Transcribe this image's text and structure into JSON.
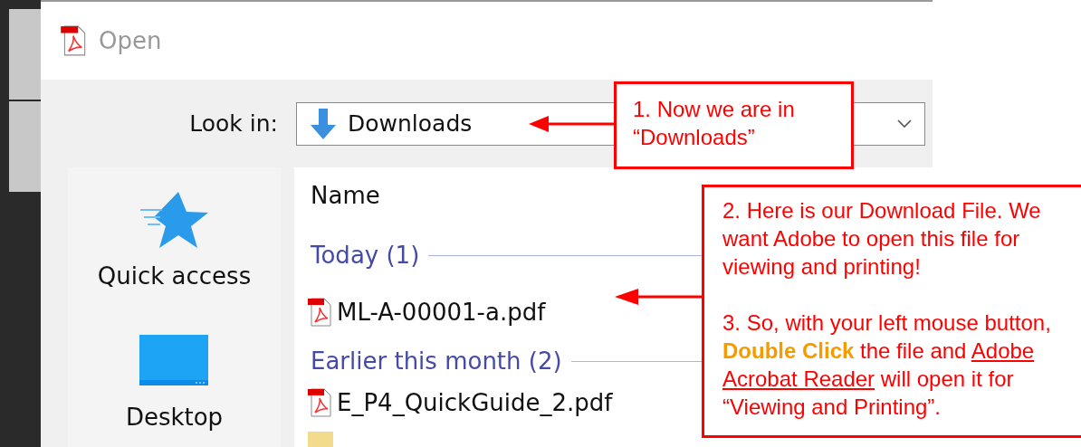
{
  "window": {
    "title": "Open"
  },
  "look_in": {
    "label": "Look in:",
    "value": "Downloads"
  },
  "sidebar": {
    "items": [
      {
        "label": "Quick access",
        "kind": "star"
      },
      {
        "label": "Desktop",
        "kind": "desktop"
      }
    ]
  },
  "file_list": {
    "column": "Name",
    "groups": [
      {
        "title": "Today (1)",
        "files": [
          {
            "name": "ML-A-00001-a.pdf",
            "kind": "pdf"
          }
        ]
      },
      {
        "title": "Earlier this month (2)",
        "files": [
          {
            "name": "E_P4_QuickGuide_2.pdf",
            "kind": "pdf"
          },
          {
            "kind": "folder"
          }
        ]
      }
    ]
  },
  "annotations": [
    {
      "text": "1. Now we are in “Downloads”"
    },
    {
      "text": "2. Here is our Download File. We want Adobe to open this file for viewing and printing!",
      "parts": [
        {
          "text": "3. So, with your left mouse button, ",
          "kind": "plain"
        },
        {
          "text": "Double Click",
          "kind": "emphasis"
        },
        {
          "text": " the file and ",
          "kind": "plain"
        },
        {
          "text": "Adobe Acrobat Reader",
          "kind": "link"
        },
        {
          "text": " will open it for “Viewing and Printing”.",
          "kind": "plain"
        }
      ]
    }
  ]
}
